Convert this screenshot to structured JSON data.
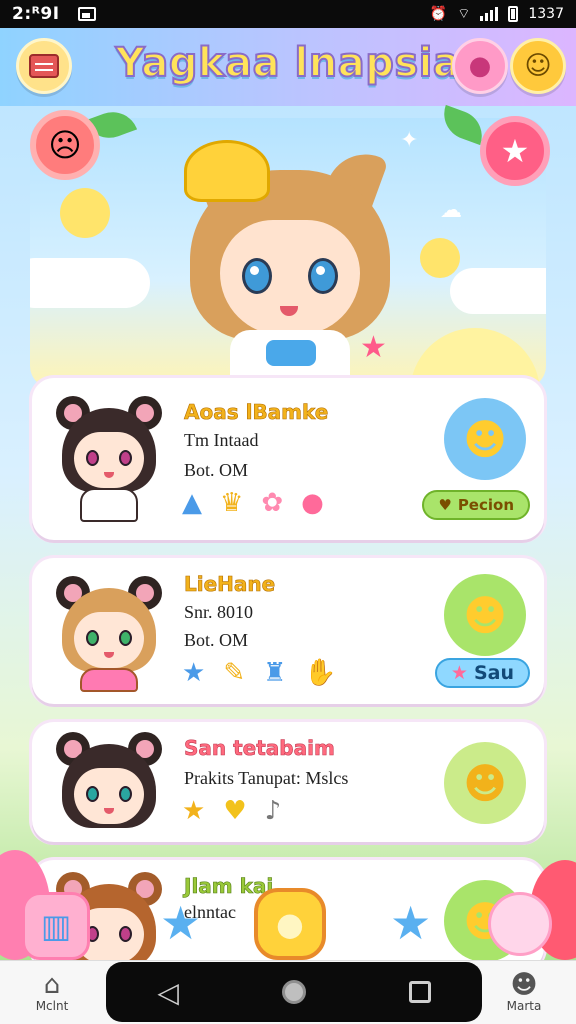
{
  "status_bar": {
    "time": "2:ᴿ9I",
    "right_text": "1337"
  },
  "header": {
    "title": "Yagkaa lnapsia"
  },
  "icons": {
    "menu": "bag-menu-icon",
    "chat": "chat-bubble-icon",
    "profile": "smiley-face-icon",
    "hero_star": "star-icon",
    "flower": "flower-icon"
  },
  "cards": [
    {
      "name": "Aoas lBamke",
      "line1": "Tm Intaad",
      "line2": "Bot. OM",
      "pill": "Pecion",
      "icons": [
        "▲",
        "♛",
        "✿",
        "●"
      ]
    },
    {
      "name": "LieHane",
      "line1": "Snr. 8010",
      "line2": "Bot. OM",
      "pill": "Sau",
      "icons": [
        "★",
        "✎",
        "♜",
        "✋"
      ]
    },
    {
      "name": "San tetabaim",
      "line1": "Prakits Tanupat: Mslcs",
      "icons": [
        "★",
        "♥",
        "♪"
      ]
    },
    {
      "name": "Jlam kai",
      "line1": "elnntac"
    }
  ],
  "nav": {
    "home_label": "Mclnt",
    "profile_label": "Marta"
  },
  "colors": {
    "accent": "#ffc93c",
    "pink": "#ff6a7e",
    "green_pill": "#a9e46a",
    "blue_pill": "#8fd8ff"
  }
}
